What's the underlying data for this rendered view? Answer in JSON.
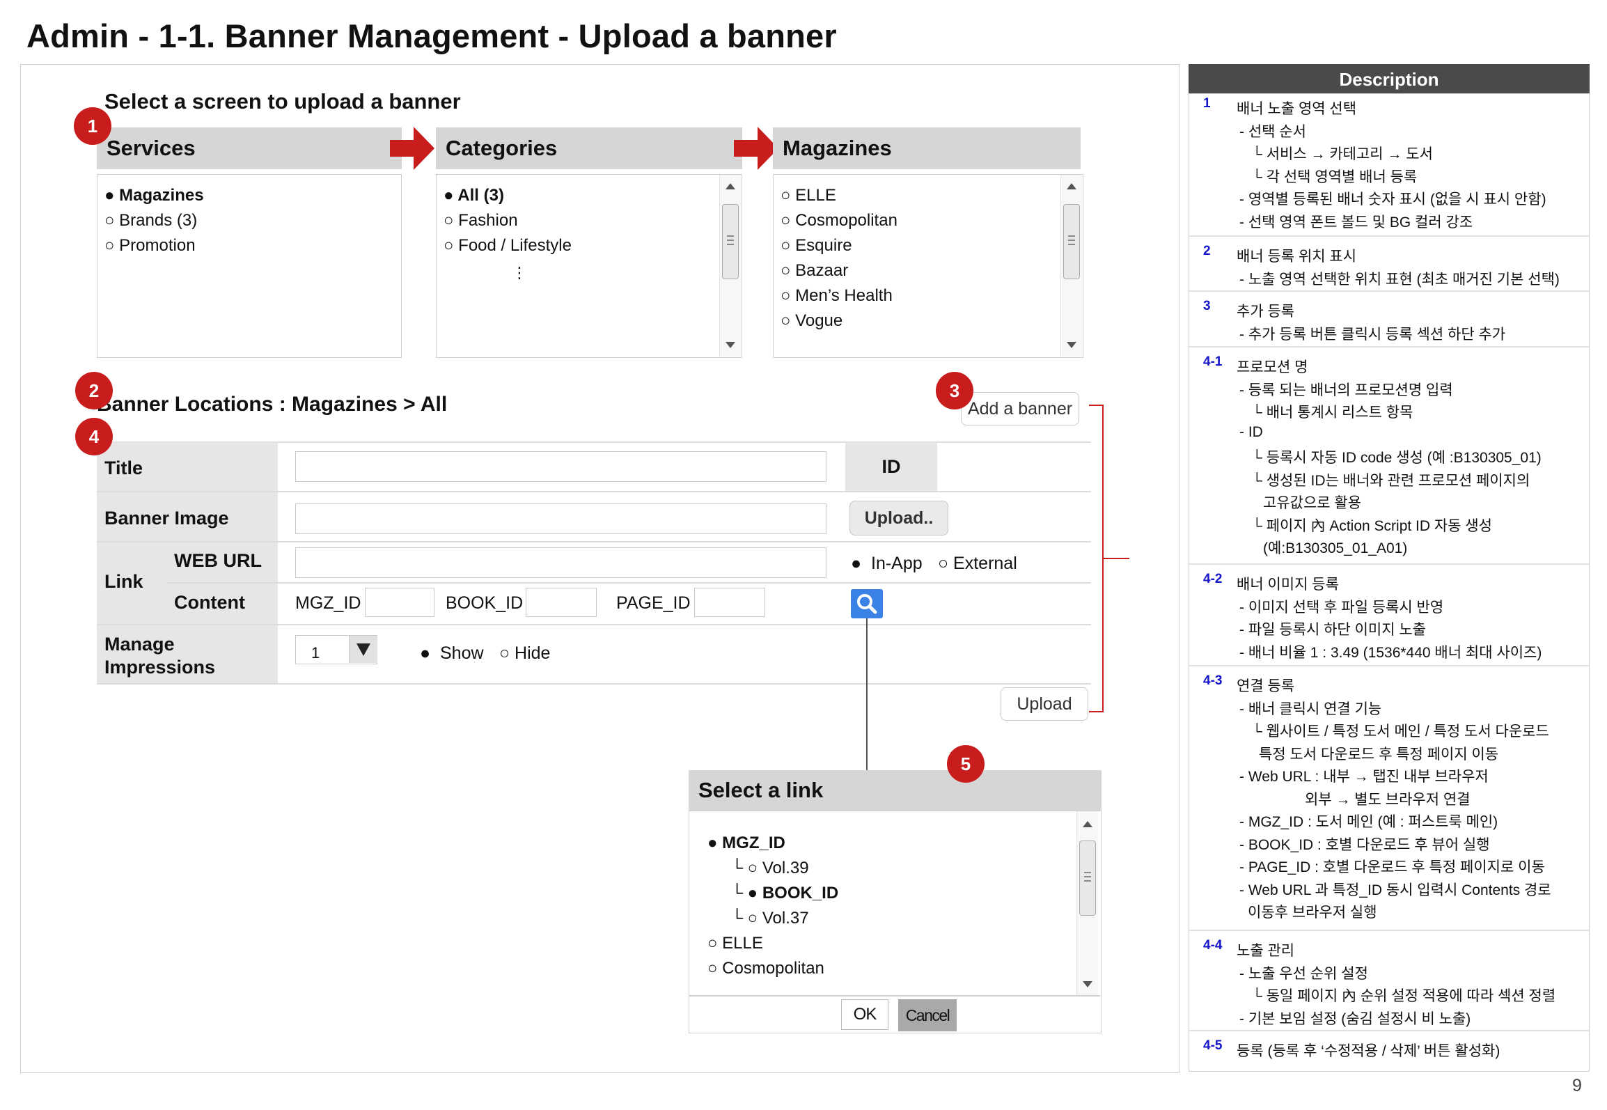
{
  "page_title": "Admin - 1-1. Banner Management - Upload a banner",
  "section_label": "Select a screen to upload a banner",
  "services": {
    "header": "Services",
    "items": [
      {
        "marker": "●",
        "label": "Magazines",
        "selected": true
      },
      {
        "marker": "○",
        "label": "Brands (3)",
        "selected": false
      },
      {
        "marker": "○",
        "label": "Promotion",
        "selected": false
      }
    ]
  },
  "categories": {
    "header": "Categories",
    "items": [
      {
        "marker": "●",
        "label": "All (3)",
        "selected": true
      },
      {
        "marker": "○",
        "label": "Fashion",
        "selected": false
      },
      {
        "marker": "○",
        "label": "Food / Lifestyle",
        "selected": false
      }
    ],
    "ellipsis": "⋮"
  },
  "magazines": {
    "header": "Magazines",
    "items": [
      {
        "marker": "○",
        "label": "ELLE"
      },
      {
        "marker": "○",
        "label": "Cosmopolitan"
      },
      {
        "marker": "○",
        "label": "Esquire"
      },
      {
        "marker": "○",
        "label": "Bazaar"
      },
      {
        "marker": "○",
        "label": "Men’s Health"
      },
      {
        "marker": "○",
        "label": "Vogue"
      }
    ]
  },
  "badges": [
    "1",
    "2",
    "3",
    "4",
    "5"
  ],
  "banner_locations": "Banner Locations : Magazines > All",
  "add_banner_label": "Add a banner",
  "form": {
    "title_label": "Title",
    "id_label": "ID",
    "banner_image_label": "Banner Image",
    "upload_file_label": "Upload..",
    "link_label": "Link",
    "web_url_label": "WEB URL",
    "content_label": "Content",
    "in_app_label": "In-App",
    "external_label": "External",
    "mgz_id_label": "MGZ_ID",
    "book_id_label": "BOOK_ID",
    "page_id_label": "PAGE_ID",
    "manage_label_1": "Manage",
    "manage_label_2": "Impressions",
    "priority_value": "1",
    "show_label": "Show",
    "hide_label": "Hide",
    "upload_button": "Upload"
  },
  "select_link": {
    "header": "Select a link",
    "items": [
      {
        "text": "● MGZ_ID"
      },
      {
        "text": "└ ○ Vol.39"
      },
      {
        "text": "└ ● BOOK_ID"
      },
      {
        "text": "└ ○ Vol.37"
      },
      {
        "text": "○ ELLE"
      },
      {
        "text": "○ Cosmopolitan"
      }
    ],
    "ok": "OK",
    "cancel": "Cancel"
  },
  "description": {
    "header": "Description",
    "sections": [
      {
        "num": "1",
        "lines": [
          "배너 노출 영역 선택",
          "- 선택 순서",
          "└ 서비스 → 카테고리 → 도서",
          "└ 각 선택 영역별 배너 등록",
          "- 영역별 등록된 배너 숫자 표시 (없을 시 표시 안함)",
          "- 선택 영역 폰트 볼드 및 BG 컬러 강조"
        ]
      },
      {
        "num": "2",
        "lines": [
          "배너 등록 위치 표시",
          "- 노출 영역 선택한 위치 표현 (최초 매거진 기본 선택)"
        ]
      },
      {
        "num": "3",
        "lines": [
          "추가 등록",
          "- 추가 등록 버튼 클릭시 등록 섹션 하단 추가"
        ]
      },
      {
        "num": "4-1",
        "lines": [
          "프로모션 명",
          "- 등록 되는 배너의 프로모션명 입력",
          "└ 배너 통계시 리스트 항목",
          "- ID",
          "└ 등록시 자동 ID code 생성 (예 :B130305_01)",
          "└ 생성된 ID는 배너와 관련 프로모션 페이지의",
          "고유값으로 활용",
          "└ 페이지 內 Action Script ID 자동 생성",
          "(예:B130305_01_A01)"
        ]
      },
      {
        "num": "4-2",
        "lines": [
          "배너 이미지 등록",
          "- 이미지 선택 후 파일 등록시 반영",
          "- 파일 등록시 하단 이미지 노출",
          "- 배너 비율 1 : 3.49 (1536*440 배너 최대 사이즈)"
        ]
      },
      {
        "num": "4-3",
        "lines": [
          "연결 등록",
          "- 배너 클릭시 연결 기능",
          "└ 웹사이트 / 특정 도서 메인 / 특정 도서 다운로드",
          "특정 도서 다운로드 후 특정 페이지 이동",
          "- Web URL : 내부 → 탭진 내부 브라우저",
          "외부 → 별도 브라우저 연결",
          "- MGZ_ID : 도서 메인 (예 : 퍼스트룩 메인)",
          "- BOOK_ID : 호별 다운로드 후 뷰어 실행",
          "- PAGE_ID : 호별 다운로드 후 특정 페이지로 이동",
          "- Web URL 과 특정_ID 동시 입력시 Contents 경로",
          "이동후 브라우저 실행"
        ]
      },
      {
        "num": "4-4",
        "lines": [
          "노출 관리",
          "- 노출 우선 순위 설정",
          "└ 동일 페이지 內 순위 설정 적용에 따라 섹션 정렬",
          "- 기본 보임 설정 (숨김 설정시 비 노출)"
        ]
      },
      {
        "num": "4-5",
        "lines": [
          "등록 (등록 후 ‘수정적용 / 삭제’ 버튼 활성화)"
        ]
      }
    ]
  },
  "page_number": "9"
}
